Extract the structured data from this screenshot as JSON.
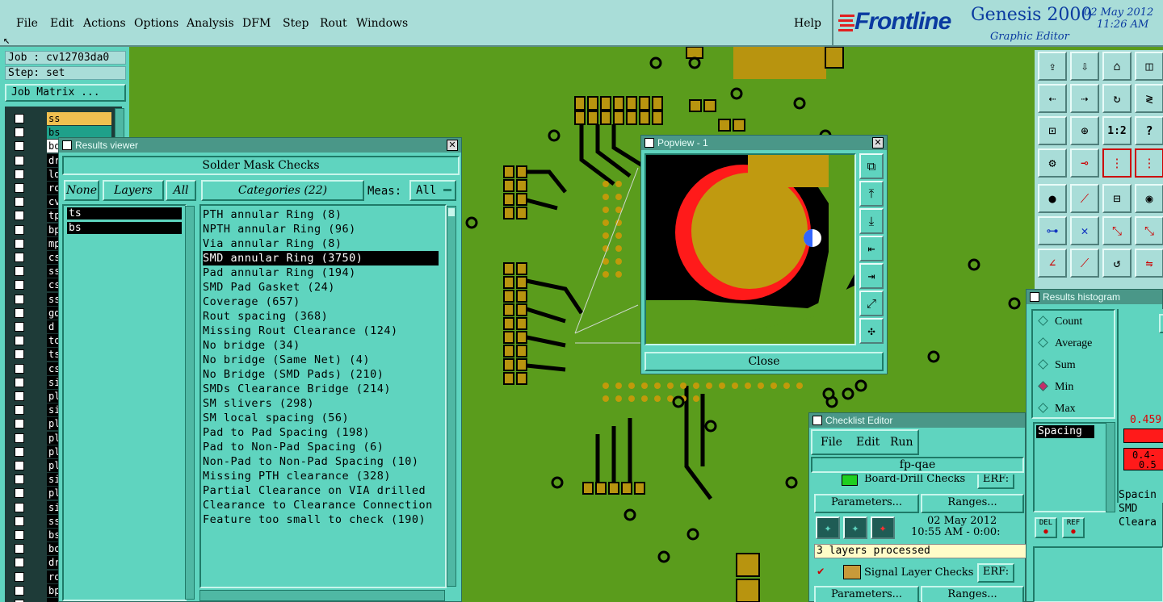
{
  "menubar": {
    "items": [
      "File",
      "Edit",
      "Actions",
      "Options",
      "Analysis",
      "DFM",
      "Step",
      "Rout",
      "Windows"
    ],
    "help": "Help"
  },
  "brand": {
    "logo_text": "Frontline",
    "product": "Genesis 2000",
    "subtitle": "Graphic Editor",
    "date": "02 May 2012",
    "time": "11:26 AM"
  },
  "left_panel": {
    "job": "Job : cv12703da0",
    "step": "Step: set",
    "job_matrix": "Job Matrix ...",
    "layers": [
      "ss",
      "bs",
      "bo",
      "drl",
      "ldi",
      "rout",
      "cvia",
      "tp",
      "bp",
      "mptl",
      "cs2",
      "ss2",
      "cs3",
      "ss3",
      "gd1",
      "d",
      "to.c",
      "ts.c",
      "cs.c",
      "sig2",
      "pln3",
      "sig3",
      "pln5",
      "pln6",
      "pln7",
      "pln8",
      "sig5",
      "pln1",
      "sig6",
      "ss.c",
      "bs.c",
      "bo.c",
      "drl",
      "rout",
      "bp.c",
      "gd1",
      "tp.c"
    ]
  },
  "results_viewer": {
    "title": "Results viewer",
    "header": "Solder Mask Checks",
    "none_btn": "None",
    "layers_btn": "Layers",
    "all_btn": "All",
    "categories_btn": "Categories (22)",
    "meas_label": "Meas:",
    "meas_value": "All",
    "layer_list": [
      "ts",
      "bs"
    ],
    "categories": [
      "PTH annular Ring (8)",
      "NPTH annular Ring (96)",
      "Via annular Ring (8)",
      "SMD annular Ring (3750)",
      "Pad annular Ring (194)",
      "SMD Pad Gasket (24)",
      "Coverage (657)",
      "Rout spacing (368)",
      "Missing Rout Clearance (124)",
      "No bridge (34)",
      "No bridge (Same Net) (4)",
      "No Bridge (SMD Pads) (210)",
      "SMDs Clearance Bridge (214)",
      "SM slivers (298)",
      "SM local spacing (56)",
      "Pad to Pad Spacing (198)",
      "Pad to Non-Pad Spacing (6)",
      "Non-Pad to Non-Pad Spacing (10)",
      "Missing PTH clearance (328)",
      "Partial Clearance on VIA drilled",
      "Clearance to Clearance Connection",
      "Feature too small to check (190)"
    ]
  },
  "popview": {
    "title": "Popview - 1",
    "close": "Close"
  },
  "histogram": {
    "title": "Results histogram",
    "options": [
      "Count",
      "Average",
      "Sum",
      "Min",
      "Max"
    ],
    "selected": "Min",
    "list_item": "Spacing",
    "value1": "0.459",
    "value2_a": "0.4-",
    "value2_b": "0.5",
    "del": "DEL",
    "ref": "REF",
    "right_text": [
      "Spacin",
      "SMD",
      "Cleara"
    ],
    "s_btn": "S"
  },
  "checklist": {
    "title": "Checklist Editor",
    "menu": [
      "File",
      "Edit",
      "Run"
    ],
    "name": "fp-qae",
    "item1": "Board-Drill Checks",
    "erf": "ERF:",
    "params": "Parameters...",
    "ranges": "Ranges...",
    "date": "02 May 2012",
    "time_range": "10:55 AM - 0:00:",
    "status": "3 layers processed",
    "item2": "Signal Layer Checks"
  },
  "colors": {
    "board_green": "#5a9c1c",
    "copper": "#b8940f",
    "panel_teal": "#5fd4bf",
    "highlight_red": "#ff1a1a"
  }
}
